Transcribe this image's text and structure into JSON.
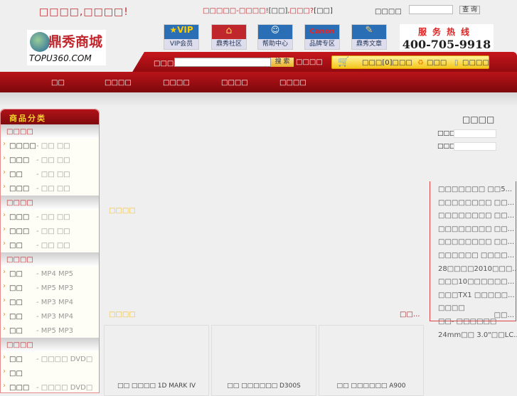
{
  "header": {
    "welcome": "□□□□,□□□□!",
    "notice": "□□□□□-□□□□!",
    "notice_link1": "[□□]",
    "notice_mid": ",□□□?",
    "notice_link2": "[□□]",
    "search_label": "□□□□",
    "search_button": "查 询"
  },
  "logo": {
    "brand": "鼎秀商城",
    "url_text": "TOPU360.COM"
  },
  "quick_links": [
    {
      "label": "VIP会员",
      "color": "#2a6fb5"
    },
    {
      "label": "鼎秀社区",
      "color": "#c0272d"
    },
    {
      "label": "帮助中心",
      "color": "#2a6fb5"
    },
    {
      "label": "品牌专区",
      "color": "#2a6fb5"
    },
    {
      "label": "鼎秀文章",
      "color": "#2a6fb5"
    }
  ],
  "hotline": {
    "title": "服务热线",
    "number": "400-705-9918"
  },
  "search": {
    "label": "□□□",
    "button": "搜 索",
    "advanced": "□□□□"
  },
  "cart": {
    "cart_text": "□□□[0]□□□",
    "link1": "□□□",
    "link2": "□□□□"
  },
  "nav": [
    "□□",
    "□□□□",
    "□□□□",
    "□□□□",
    "□□□□"
  ],
  "sidebar": {
    "title": "商品分类",
    "sections": [
      {
        "title": "□□□□",
        "items": [
          {
            "name": "□□□□",
            "sub": "- □□ □□"
          },
          {
            "name": "□□□",
            "sub": "- □□ □□"
          },
          {
            "name": "□□",
            "sub": "- □□ □□"
          },
          {
            "name": "□□□",
            "sub": "- □□ □□"
          }
        ]
      },
      {
        "title": "□□□□",
        "items": [
          {
            "name": "□□□",
            "sub": "- □□ □□"
          },
          {
            "name": "□□□",
            "sub": "- □□ □□"
          },
          {
            "name": "□□",
            "sub": "- □□ □□"
          }
        ]
      },
      {
        "title": "□□□□",
        "items": [
          {
            "name": "□□",
            "sub": "- MP4 MP5"
          },
          {
            "name": "□□",
            "sub": "- MP5 MP3"
          },
          {
            "name": "□□",
            "sub": "- MP3 MP4"
          },
          {
            "name": "□□",
            "sub": "- MP3 MP4"
          },
          {
            "name": "□□",
            "sub": "- MP5 MP3"
          }
        ]
      },
      {
        "title": "□□□□",
        "items": [
          {
            "name": "□□",
            "sub": "- □□□□ DVD□"
          },
          {
            "name": "□□",
            "sub": ""
          },
          {
            "name": "□□□",
            "sub": "- □□□□ DVD□"
          }
        ]
      }
    ]
  },
  "login": {
    "title": "□□□□",
    "user_label": "□□□□",
    "pass_label": "□□□□"
  },
  "news": {
    "items": [
      "□□□□□□□ □□5...",
      "□□□□□□□□ □□...",
      "□□□□□□□□ □□...",
      "□□□□□□□□ □□...",
      "□□□□□□□□ □□...",
      "□□□□□□ □□□□...",
      "28□□□□2010□□□...",
      "□□□10□□□□□□...",
      "□□□TX1 □□□□□...",
      "□□□□",
      "□□- □□□□□□",
      "24mm□□ 3.0\"□□LC..."
    ],
    "more": "□□..."
  },
  "main": {
    "section1": "□□□□",
    "section2": "□□□□",
    "more": "□□...",
    "products": [
      "□□ □□□□ 1D MARK IV",
      "□□ □□□□□□ D300S",
      "□□ □□□□□□ A900"
    ]
  }
}
